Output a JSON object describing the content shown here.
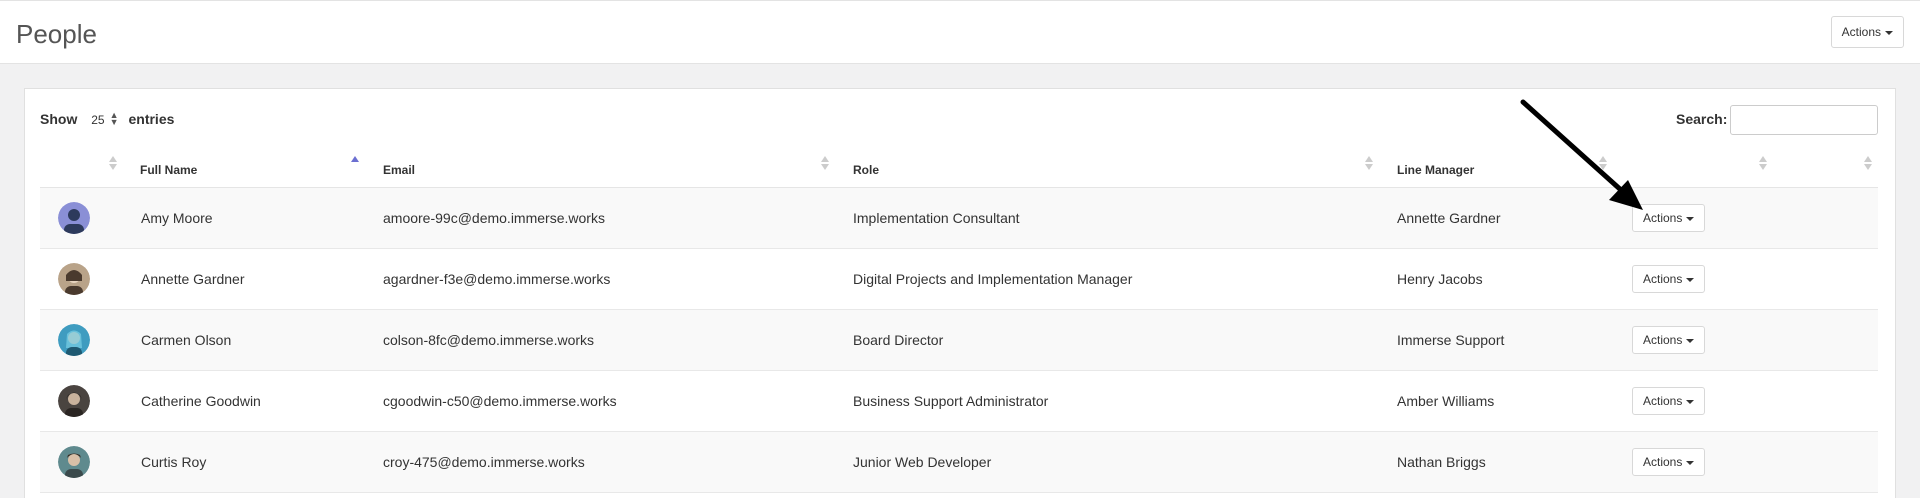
{
  "header": {
    "title": "People",
    "actions_label": "Actions"
  },
  "controls": {
    "show_label": "Show",
    "page_length": "25",
    "entries_label": "entries",
    "search_label": "Search:",
    "search_value": ""
  },
  "table": {
    "columns": [
      "Full Name",
      "Email",
      "Role",
      "Line Manager"
    ],
    "sorted_column": "Full Name",
    "sort_direction": "ascending",
    "rows": [
      {
        "name": "Amy Moore",
        "email": "amoore-99c@demo.immerse.works",
        "role": "Implementation Consultant",
        "manager": "Annette Gardner",
        "action": "Actions"
      },
      {
        "name": "Annette Gardner",
        "email": "agardner-f3e@demo.immerse.works",
        "role": "Digital Projects and Implementation Manager",
        "manager": "Henry Jacobs",
        "action": "Actions"
      },
      {
        "name": "Carmen Olson",
        "email": "colson-8fc@demo.immerse.works",
        "role": "Board Director",
        "manager": "Immerse Support",
        "action": "Actions"
      },
      {
        "name": "Catherine Goodwin",
        "email": "cgoodwin-c50@demo.immerse.works",
        "role": "Business Support Administrator",
        "manager": "Amber Williams",
        "action": "Actions"
      },
      {
        "name": "Curtis Roy",
        "email": "croy-475@demo.immerse.works",
        "role": "Junior Web Developer",
        "manager": "Nathan Briggs",
        "action": "Actions"
      }
    ]
  },
  "colors": {
    "sort_active": "#6b6fd1",
    "avatar_1": "#8a8fd6",
    "avatar_2": "#b9a389",
    "avatar_3": "#3f9cc0",
    "avatar_4": "#4a4440",
    "avatar_5": "#5f8a8e"
  }
}
